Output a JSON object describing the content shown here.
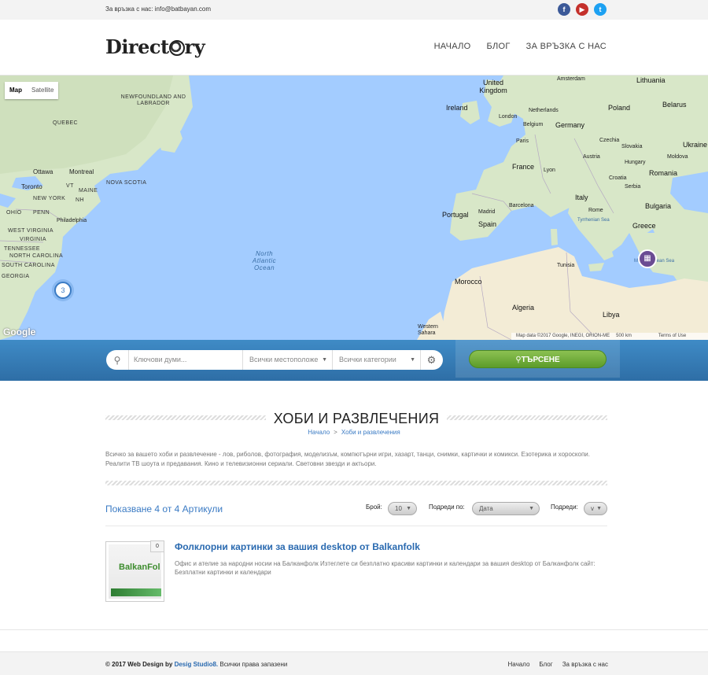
{
  "topbar": {
    "contact": "За връзка с нас: info@batbayan.com",
    "social": [
      {
        "icon": "facebook-icon",
        "glyph": "f",
        "color": "#3b5998"
      },
      {
        "icon": "youtube-icon",
        "glyph": "▶",
        "color": "#c4302b"
      },
      {
        "icon": "twitter-icon",
        "glyph": "t",
        "color": "#1da1f2"
      }
    ]
  },
  "header": {
    "logo_pre": "Direct",
    "logo_post": "ry",
    "nav": [
      "НАЧАЛО",
      "БЛОГ",
      "ЗА ВРЪЗКА С НАС"
    ]
  },
  "map": {
    "type_map": "Map",
    "type_satellite": "Satellite",
    "cluster_count": "3",
    "pin_icon": "building-icon",
    "google": "Google",
    "footer": [
      "Map data ©2017 Google, INEGI, ORION-ME",
      "500 km",
      "Terms of Use"
    ],
    "zoom_in": "+",
    "zoom_out": "−",
    "labels": {
      "united_kingdom": "United Kingdom",
      "ireland": "Ireland",
      "london": "London",
      "netherlands": "Netherlands",
      "amsterdam": "Amsterdam",
      "belgium": "Belgium",
      "germany": "Germany",
      "poland": "Poland",
      "belarus": "Belarus",
      "lithuania": "Lithuania",
      "ukraine": "Ukraine",
      "moldova": "Moldova",
      "czechia": "Czechia",
      "slovakia": "Slovakia",
      "austria": "Austria",
      "hungary": "Hungary",
      "croatia": "Croatia",
      "serbia": "Serbia",
      "romania": "Romania",
      "bulgaria": "Bulgaria",
      "greece": "Greece",
      "italy": "Italy",
      "rome": "Rome",
      "france": "France",
      "paris": "Paris",
      "lyon": "Lyon",
      "barcelona": "Barcelona",
      "spain": "Spain",
      "portugal": "Portugal",
      "madrid": "Madrid",
      "morocco": "Morocco",
      "algeria": "Algeria",
      "libya": "Libya",
      "tunisia": "Tunisia",
      "western_sahara": "Western Sahara",
      "tyrrhenian": "Tyrrhenian Sea",
      "mediterranean": "Mediterranean Sea",
      "north_atlantic": "North Atlantic Ocean",
      "newfoundland": "NEWFOUNDLAND AND LABRADOR",
      "quebec": "QUEBEC",
      "ottawa": "Ottawa",
      "montreal": "Montreal",
      "toronto": "Toronto",
      "nova_scotia": "NOVA SCOTIA",
      "new_york": "NEW YORK",
      "ohio": "OHIO",
      "penn": "PENN",
      "philadelphia": "Philadelphia",
      "west_virginia": "WEST VIRGINIA",
      "north_carolina": "NORTH CAROLINA",
      "south_carolina": "SOUTH CAROLINA",
      "georgia": "GEORGIA",
      "tennessee": "TENNESSEE",
      "virginia": "VIRGINIA",
      "maine": "MAINE",
      "vt": "VT",
      "nh": "NH"
    }
  },
  "search": {
    "keywords_placeholder": "Ключови думи...",
    "location": "Всички местоположе",
    "category": "Всички категории",
    "button": "ТЪРСЕНЕ"
  },
  "page": {
    "title": "ХОБИ И РАЗВЛЕЧЕНИЯ",
    "crumb_home": "Начало",
    "crumb_sep": ">",
    "crumb_current": "Хоби и развлечения",
    "description": "Всичко за вашето хоби и развлечение - лов, риболов, фотография, моделизъм, компютърни игри, хазарт, танци, снимки, картички и комикси. Езотерика и хороскопи. Реалити ТВ шоута и предавания. Кино и телевизионни сериали. Световни звезди и актьори."
  },
  "listing": {
    "count_text": "Показване 4 от 4 Артикули",
    "per_page_label": "Брой:",
    "per_page_value": "10",
    "sort_label": "Подреди по:",
    "sort_value": "Дата",
    "order_label": "Подреди:",
    "order_value": "v"
  },
  "articles": [
    {
      "title": "Фолклорни картинки за вашия desktop от Balkanfolk",
      "excerpt": "Офис и ателие за народни носии на Балканфолк Изтеглете си безплатно красиви картинки и календари за вашия desktop от Балканфолк сайт: Безплатни картинки и календари",
      "comments": "0",
      "thumb_text": "BalkanFol"
    }
  ],
  "footer": {
    "copyright_pre": "© 2017 Web Design by",
    "studio": "Desig Studio8.",
    "rights": "Всички права запазени",
    "nav": [
      "Начало",
      "Блог",
      "За връзка с нас"
    ]
  }
}
